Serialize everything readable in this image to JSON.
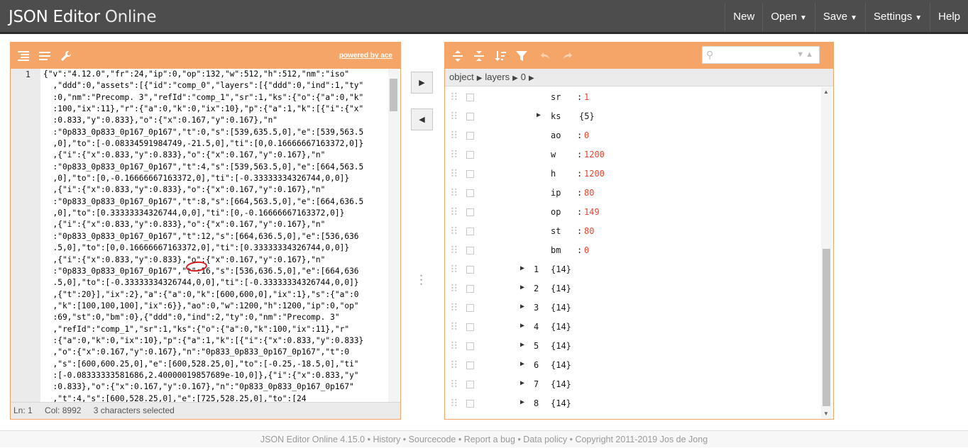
{
  "app": {
    "logo_bold": "JSON Editor",
    "logo_thin": "Online",
    "menu": [
      {
        "label": "New",
        "dropdown": false
      },
      {
        "label": "Open",
        "dropdown": true
      },
      {
        "label": "Save",
        "dropdown": true
      },
      {
        "label": "Settings",
        "dropdown": true
      },
      {
        "label": "Help",
        "dropdown": false
      }
    ]
  },
  "left_editor": {
    "powered_by": "powered by ace",
    "line_number": "1",
    "code_lines": [
      "{\"v\":\"4.12.0\",\"fr\":24,\"ip\":0,\"op\":132,\"w\":512,\"h\":512,\"nm\":\"iso\"",
      "  ,\"ddd\":0,\"assets\":[{\"id\":\"comp_0\",\"layers\":[{\"ddd\":0,\"ind\":1,\"ty\"",
      "  :0,\"nm\":\"Precomp. 3\",\"refId\":\"comp_1\",\"sr\":1,\"ks\":{\"o\":{\"a\":0,\"k\"",
      "  :100,\"ix\":11},\"r\":{\"a\":0,\"k\":0,\"ix\":10},\"p\":{\"a\":1,\"k\":[{\"i\":{\"x\"",
      "  :0.833,\"y\":0.833},\"o\":{\"x\":0.167,\"y\":0.167},\"n\"",
      "  :\"0p833_0p833_0p167_0p167\",\"t\":0,\"s\":[539,635.5,0],\"e\":[539,563.5",
      "  ,0],\"to\":[-0.08334591984749,-21.5,0],\"ti\":[0,0.16666667163372,0]}",
      "  ,{\"i\":{\"x\":0.833,\"y\":0.833},\"o\":{\"x\":0.167,\"y\":0.167},\"n\"",
      "  :\"0p833_0p833_0p167_0p167\",\"t\":4,\"s\":[539,563.5,0],\"e\":[664,563.5",
      "  ,0],\"to\":[0,-0.16666667163372,0],\"ti\":[-0.33333334326744,0,0]}",
      "  ,{\"i\":{\"x\":0.833,\"y\":0.833},\"o\":{\"x\":0.167,\"y\":0.167},\"n\"",
      "  :\"0p833_0p833_0p167_0p167\",\"t\":8,\"s\":[664,563.5,0],\"e\":[664,636.5",
      "  ,0],\"to\":[0.33333334326744,0,0],\"ti\":[0,-0.16666667163372,0]}",
      "  ,{\"i\":{\"x\":0.833,\"y\":0.833},\"o\":{\"x\":0.167,\"y\":0.167},\"n\"",
      "  :\"0p833_0p833_0p167_0p167\",\"t\":12,\"s\":[664,636.5,0],\"e\":[536,636",
      "  .5,0],\"to\":[0,0.16666667163372,0],\"ti\":[0.33333334326744,0,0]}",
      "  ,{\"i\":{\"x\":0.833,\"y\":0.833},\"o\":{\"x\":0.167,\"y\":0.167},\"n\"",
      "  :\"0p833_0p833_0p167_0p167\",\"t\":16,\"s\":[536,636.5,0],\"e\":[664,636",
      "  .5,0],\"to\":[-0.33333334326744,0,0],\"ti\":[-0.33333334326744,0,0]}",
      "  ,{\"t\":20}],\"ix\":2},\"a\":{\"a\":0,\"k\":[600,600,0],\"ix\":1},\"s\":{\"a\":0",
      "  ,\"k\":[100,100,100],\"ix\":6}},\"ao\":0,\"w\":1200,\"h\":1200,\"ip\":0,\"op\"",
      "  :69,\"st\":0,\"bm\":0},{\"ddd\":0,\"ind\":2,\"ty\":0,\"nm\":\"Precomp. 3\"",
      "  ,\"refId\":\"comp_1\",\"sr\":1,\"ks\":{\"o\":{\"a\":0,\"k\":100,\"ix\":11},\"r\"",
      "  :{\"a\":0,\"k\":0,\"ix\":10},\"p\":{\"a\":1,\"k\":[{\"i\":{\"x\":0.833,\"y\":0.833}",
      "  ,\"o\":{\"x\":0.167,\"y\":0.167},\"n\":\"0p833_0p833_0p167_0p167\",\"t\":0",
      "  ,\"s\":[600,600.25,0],\"e\":[600,528.25,0],\"to\":[-0.25,-18.5,0],\"ti\"",
      "  :[-0.08333333581686,2.40000019857689e-10,0]},{\"i\":{\"x\":0.833,\"y\"",
      "  :0.833},\"o\":{\"x\":0.167,\"y\":0.167},\"n\":\"0p833_0p833_0p167_0p167\"",
      "  ,\"t\":4,\"s\":[600,528.25,0],\"e\":[725,528.25,0],\"to\":[24"
    ],
    "status": {
      "ln": "Ln: 1",
      "col": "Col: 8992",
      "selection": "3 characters selected"
    }
  },
  "right_editor": {
    "breadcrumb": [
      "object",
      "layers",
      "0"
    ],
    "tree_rows": [
      {
        "field": "sr",
        "value": "1",
        "kind": "value"
      },
      {
        "field": "ks",
        "value": "{5}",
        "kind": "object"
      },
      {
        "field": "ao",
        "value": "0",
        "kind": "value"
      },
      {
        "field": "w",
        "value": "1200",
        "kind": "value"
      },
      {
        "field": "h",
        "value": "1200",
        "kind": "value"
      },
      {
        "field": "ip",
        "value": "80",
        "kind": "value"
      },
      {
        "field": "op",
        "value": "149",
        "kind": "value"
      },
      {
        "field": "st",
        "value": "80",
        "kind": "value"
      },
      {
        "field": "bm",
        "value": "0",
        "kind": "value"
      },
      {
        "field": "1",
        "value": "{14}",
        "kind": "index"
      },
      {
        "field": "2",
        "value": "{14}",
        "kind": "index"
      },
      {
        "field": "3",
        "value": "{14}",
        "kind": "index"
      },
      {
        "field": "4",
        "value": "{14}",
        "kind": "index"
      },
      {
        "field": "5",
        "value": "{14}",
        "kind": "index"
      },
      {
        "field": "6",
        "value": "{14}",
        "kind": "index"
      },
      {
        "field": "7",
        "value": "{14}",
        "kind": "index"
      },
      {
        "field": "8",
        "value": "{14}",
        "kind": "index"
      }
    ]
  },
  "footer": {
    "text": "JSON Editor Online 4.15.0 • History • Sourcecode • Report a bug • Data policy • Copyright 2011-2019 Jos de Jong"
  },
  "colors": {
    "header": "#4d4d4d",
    "panel_accent": "#f4a567",
    "value_red": "#ee422e"
  }
}
